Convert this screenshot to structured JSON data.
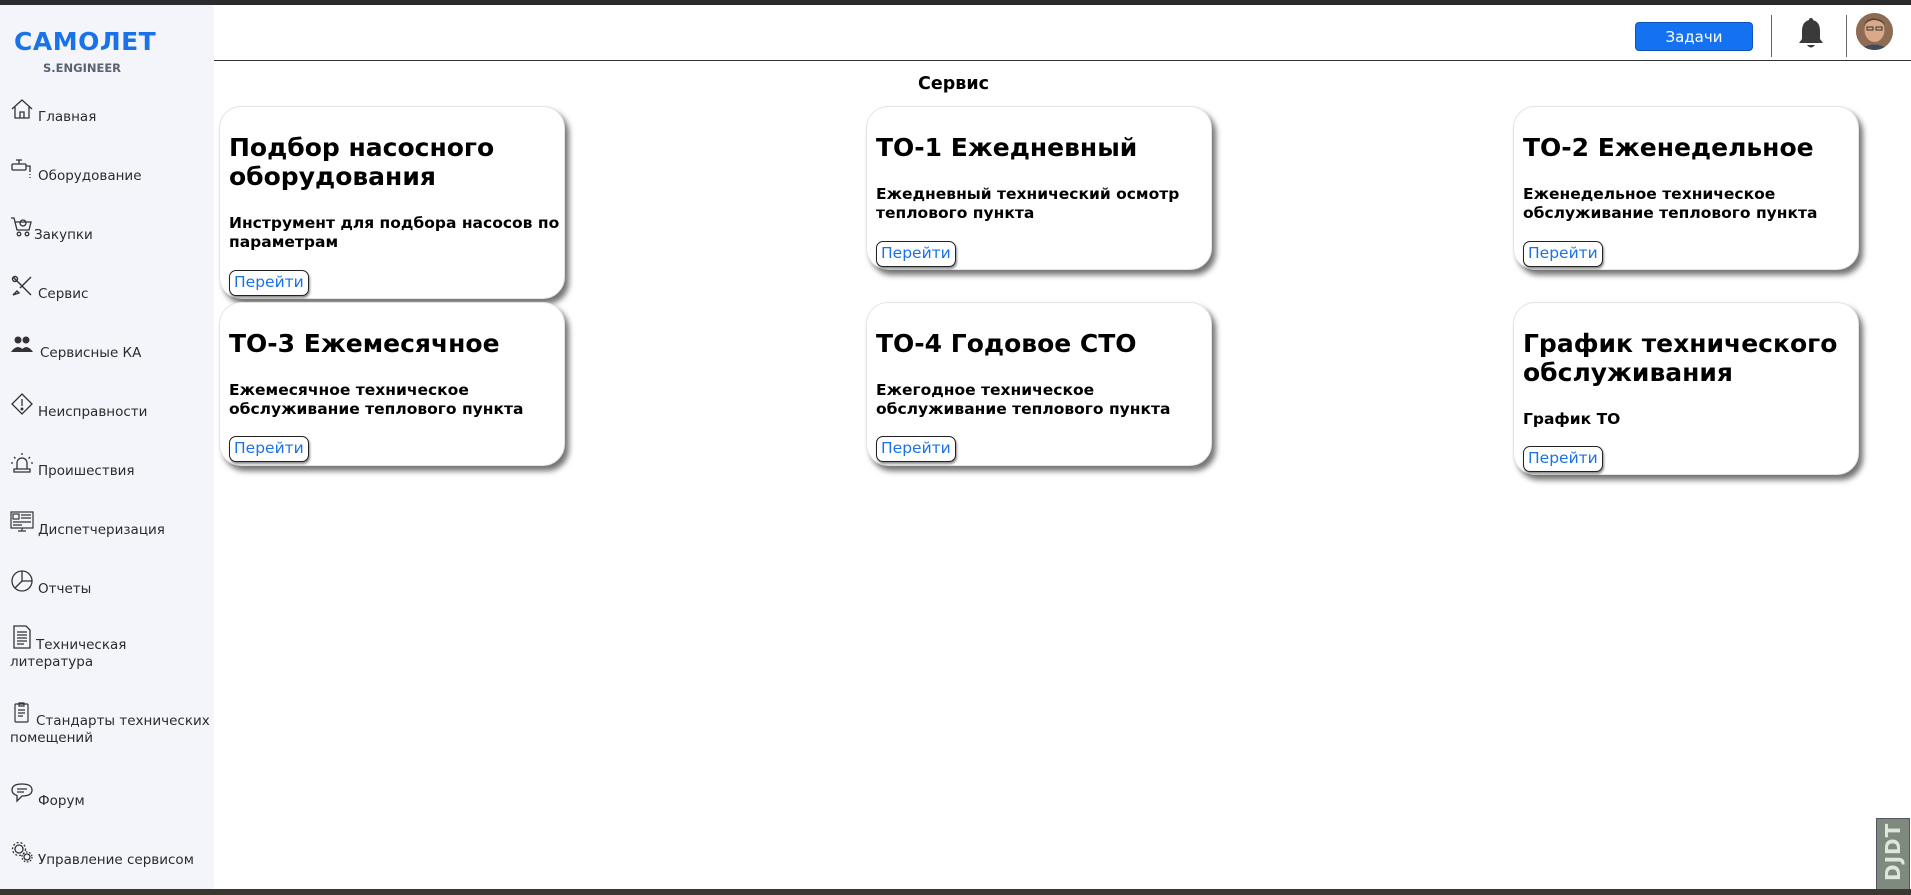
{
  "brand": {
    "name": "САМОЛЕТ",
    "sub": "S.ENGINEER",
    "color": "#1a72e8"
  },
  "sidebar": {
    "items": [
      {
        "label": "Главная",
        "icon": "home-icon"
      },
      {
        "label": "Оборудование",
        "icon": "faucet-icon"
      },
      {
        "label": "Закупки",
        "icon": "cart-icon"
      },
      {
        "label": "Сервис",
        "icon": "tools-icon"
      },
      {
        "label": "Сервисные КА",
        "icon": "users-icon"
      },
      {
        "label": "Неисправности",
        "icon": "warning-icon"
      },
      {
        "label": "Проишествия",
        "icon": "siren-icon"
      },
      {
        "label": "Диспетчеризация",
        "icon": "dashboard-icon"
      },
      {
        "label": "Отчеты",
        "icon": "pie-chart-icon"
      },
      {
        "label": "Техническая литература",
        "icon": "document-icon"
      },
      {
        "label": "Стандарты технических помещений",
        "icon": "clipboard-icon"
      },
      {
        "label": "Форум",
        "icon": "chat-icon"
      },
      {
        "label": "Управление сервисом",
        "icon": "gears-icon"
      }
    ]
  },
  "header": {
    "tasks_label": "Задачи",
    "tasks_color": "#1472f2",
    "bell_icon": "bell-icon",
    "avatar_icon": "user-avatar"
  },
  "page": {
    "title": "Сервис"
  },
  "cards": [
    {
      "title": "Подбор насосного оборудования",
      "description": "Инструмент для подбора насосов по параметрам",
      "button": "Перейти"
    },
    {
      "title": "ТО-1 Ежедневный",
      "description": "Ежедневный технический осмотр теплового пункта",
      "button": "Перейти"
    },
    {
      "title": "ТО-2 Еженедельное",
      "description": "Еженедельное техническое обслуживание теплового пункта",
      "button": "Перейти"
    },
    {
      "title": "ТО-3 Ежемесячное",
      "description": "Ежемесячное техническое обслуживание теплового пункта",
      "button": "Перейти"
    },
    {
      "title": "ТО-4 Годовое СТО",
      "description": "Ежегодное техническое обслуживание теплового пункта",
      "button": "Перейти"
    },
    {
      "title": "График технического обслуживания",
      "description": "График ТО",
      "button": "Перейти"
    }
  ],
  "badge": {
    "text": "DJDT"
  }
}
